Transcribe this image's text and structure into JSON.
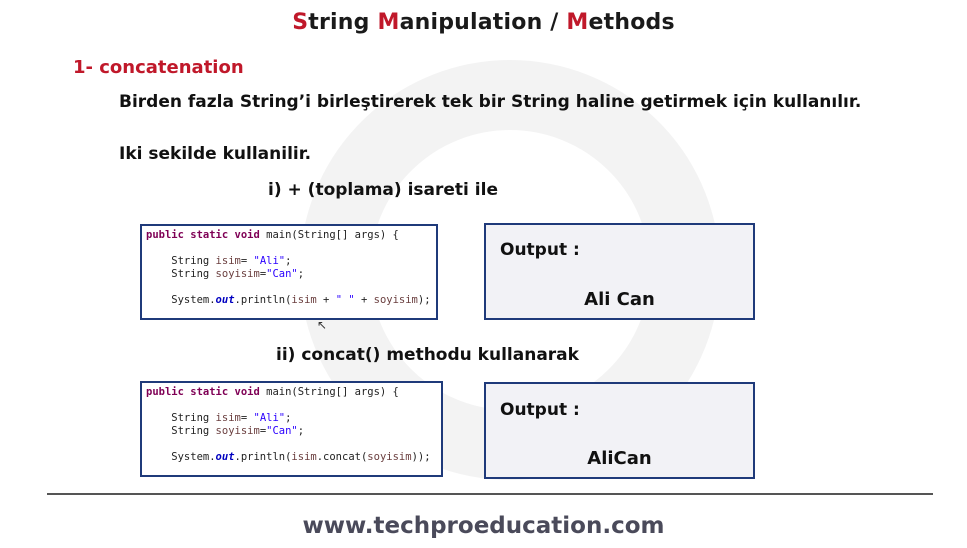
{
  "title": {
    "s": "S",
    "t1": "tring ",
    "m": "M",
    "t2": "anipulation / ",
    "m2": "M",
    "t3": "ethods"
  },
  "section_heading": "1- concatenation",
  "description": "Birden fazla String’i birleştirerek tek bir String haline getirmek için kullanılır.",
  "usage_note": "Iki sekilde kullanilir.",
  "method1": {
    "heading": "i)  + (toplama) isareti ile",
    "code": {
      "l1_kw": "public static void",
      "l1_rest": " main(String[] args) {",
      "l2_pre": "    String ",
      "l2_var": "isim",
      "l2_mid": "= ",
      "l2_str": "\"Ali\"",
      "l2_end": ";",
      "l3_pre": "    String ",
      "l3_var": "soyisim",
      "l3_mid": "=",
      "l3_str": "\"Can\"",
      "l3_end": ";",
      "l4_pre": "    System.",
      "l4_fld": "out",
      "l4_mid": ".println(",
      "l4_v1": "isim",
      "l4_plus1": " + ",
      "l4_str": "\" \"",
      "l4_plus2": " + ",
      "l4_v2": "soyisim",
      "l4_end": ");"
    },
    "output_label": "Output :",
    "output_value": "Ali Can"
  },
  "method2": {
    "heading": "ii)  concat() methodu kullanarak",
    "code": {
      "l1_kw": "public static void",
      "l1_rest": " main(String[] args) {",
      "l2_pre": "    String ",
      "l2_var": "isim",
      "l2_mid": "= ",
      "l2_str": "\"Ali\"",
      "l2_end": ";",
      "l3_pre": "    String ",
      "l3_var": "soyisim",
      "l3_mid": "=",
      "l3_str": "\"Can\"",
      "l3_end": ";",
      "l4_pre": "    System.",
      "l4_fld": "out",
      "l4_mid": ".println(",
      "l4_v1": "isim",
      "l4_dot": ".concat(",
      "l4_v2": "soyisim",
      "l4_end": "));"
    },
    "output_label": "Output :",
    "output_value": "AliCan"
  },
  "footer": "www.techproeducation.com",
  "colors": {
    "accent_red": "#c0182a",
    "box_border": "#1f3a7a",
    "output_bg": "#f2f2f6"
  }
}
